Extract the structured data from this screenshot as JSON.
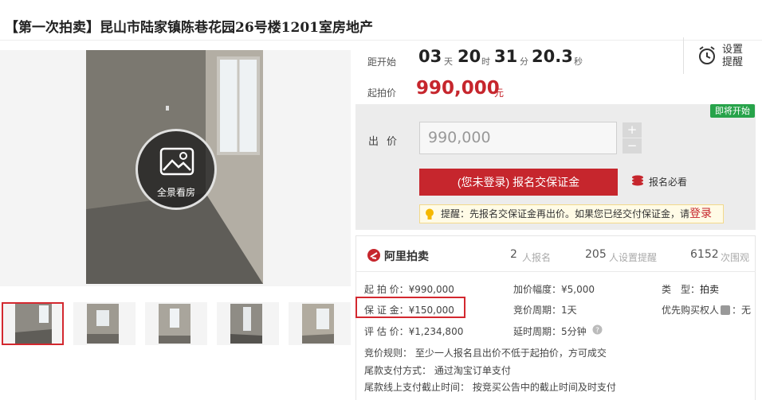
{
  "page_title": "【第一次拍卖】昆山市陆家镇陈巷花园26号楼1201室房地产",
  "gallery": {
    "panorama_label": "全景看房"
  },
  "countdown": {
    "label": "距开始",
    "days": "03",
    "days_unit": "天",
    "hours": "20",
    "hours_unit": "时",
    "minutes": "31",
    "minutes_unit": "分",
    "seconds": "20.3",
    "seconds_unit": "秒"
  },
  "reminder": {
    "label": "设置提醒"
  },
  "start_price": {
    "label": "起拍价",
    "value": "990,000",
    "unit": "元"
  },
  "status_tag": "即将开始",
  "bid": {
    "label": "出价",
    "value": "990,000",
    "plus": "+",
    "minus": "−",
    "register_button": "(您未登录) 报名交保证金",
    "must_read": "报名必看",
    "hint_text": "提醒：先报名交保证金再出价。如果您已经交付保证金，请",
    "hint_link": "登录"
  },
  "stats": {
    "logo": "阿里拍卖",
    "registrants": "2",
    "registrants_label": "人报名",
    "reminders": "205",
    "reminders_label": "人设置提醒",
    "views": "6152",
    "views_label": "次围观"
  },
  "details": {
    "start_price": "起 拍 价：¥990,000",
    "deposit": "保 证 金：¥150,000",
    "appraisal": "评 估 价：¥1,234,800",
    "increment": "加价幅度：¥5,000",
    "cycle": "竞价周期：1天",
    "delay": "延时周期：5分钟",
    "type_label": "类　型：",
    "type_value": "拍卖",
    "priority": "优先购买权人",
    "priority_suffix": "：无",
    "rule": "竞价规则：  至少一人报名且出价不低于起拍价，方可成交",
    "payment": "尾款支付方式：  通过淘宝订单支付",
    "deadline": "尾款线上支付截止时间：  按竞买公告中的截止时间及时支付"
  },
  "colors": {
    "accent_red": "#c6262d",
    "tag_green": "#27a34a"
  }
}
